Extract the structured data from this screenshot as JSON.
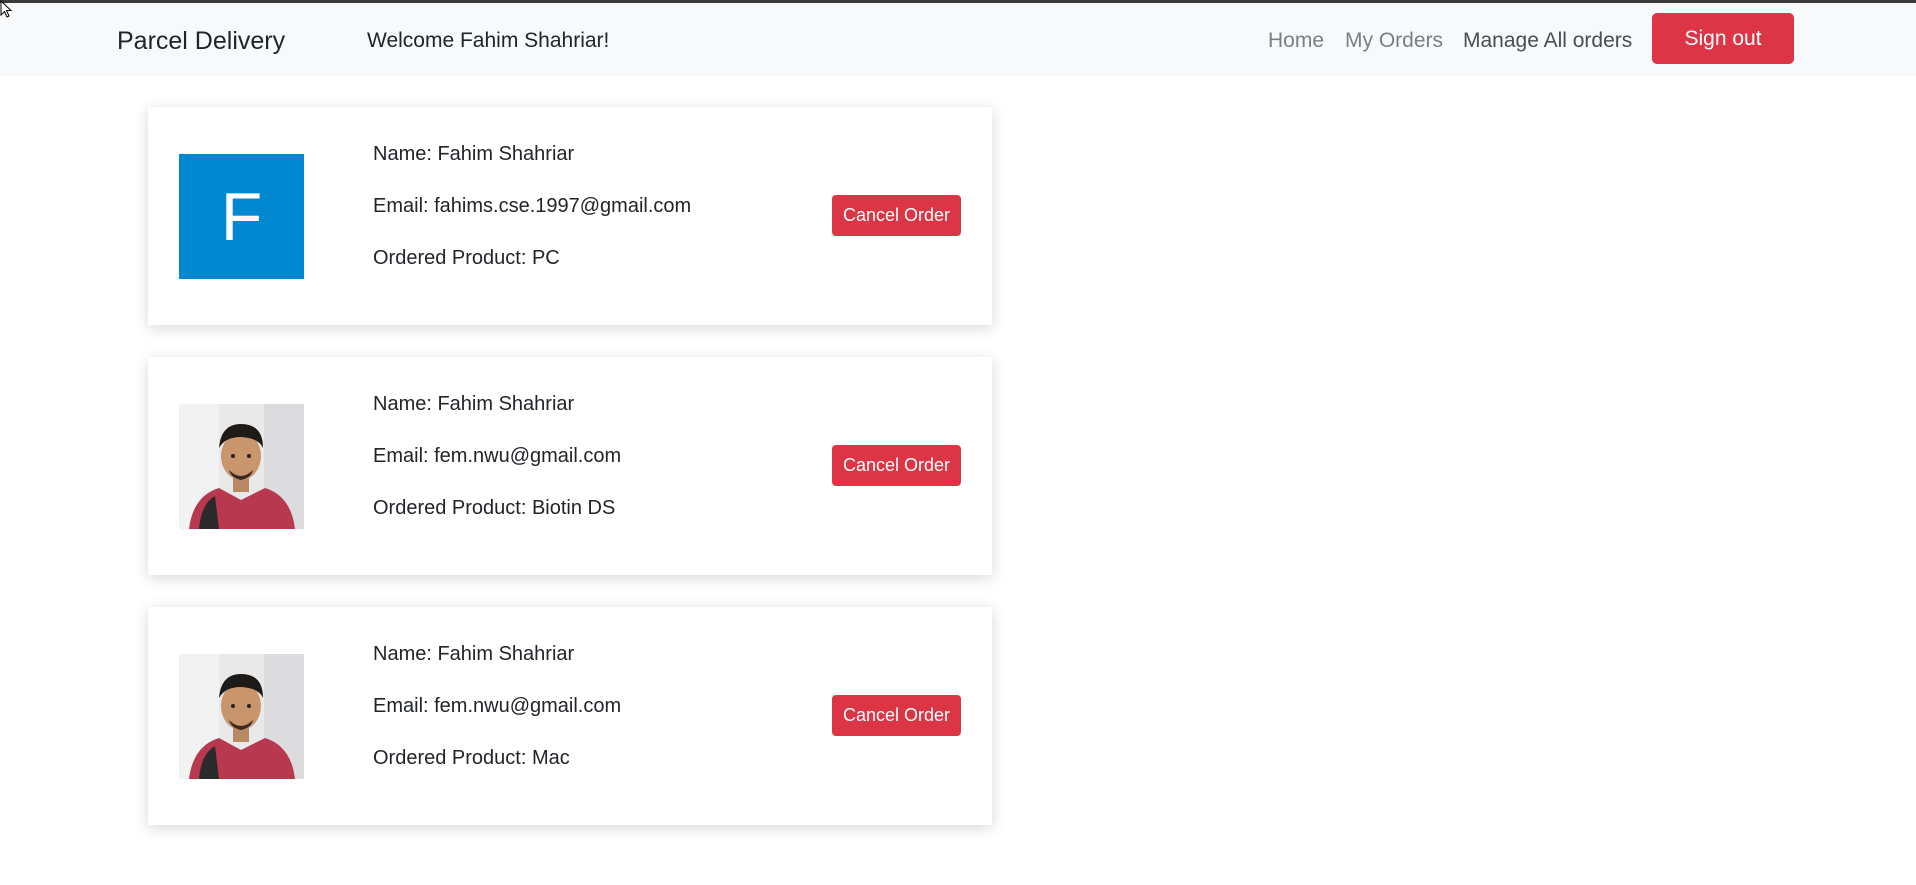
{
  "navbar": {
    "brand": "Parcel Delivery",
    "welcome": "Welcome Fahim Shahriar!",
    "links": [
      "Home",
      "My Orders",
      "Manage All orders"
    ],
    "sign_out_label": "Sign out"
  },
  "orders": [
    {
      "avatar_type": "letter",
      "avatar_letter": "F",
      "name_line": "Name: Fahim Shahriar",
      "email_line": "Email: fahims.cse.1997@gmail.com",
      "product_line": "Ordered Product: PC",
      "cancel_label": "Cancel Order"
    },
    {
      "avatar_type": "photo",
      "name_line": "Name: Fahim Shahriar",
      "email_line": "Email: fem.nwu@gmail.com",
      "product_line": "Ordered Product: Biotin DS",
      "cancel_label": "Cancel Order"
    },
    {
      "avatar_type": "photo",
      "name_line": "Name: Fahim Shahriar",
      "email_line": "Email: fem.nwu@gmail.com",
      "product_line": "Ordered Product: Mac",
      "cancel_label": "Cancel Order"
    }
  ],
  "colors": {
    "danger": "#dc3545",
    "avatar_blue": "#0288d1",
    "navbar_bg": "#f8f9fa"
  },
  "icons": {
    "cursor": "mouse-pointer-icon"
  }
}
